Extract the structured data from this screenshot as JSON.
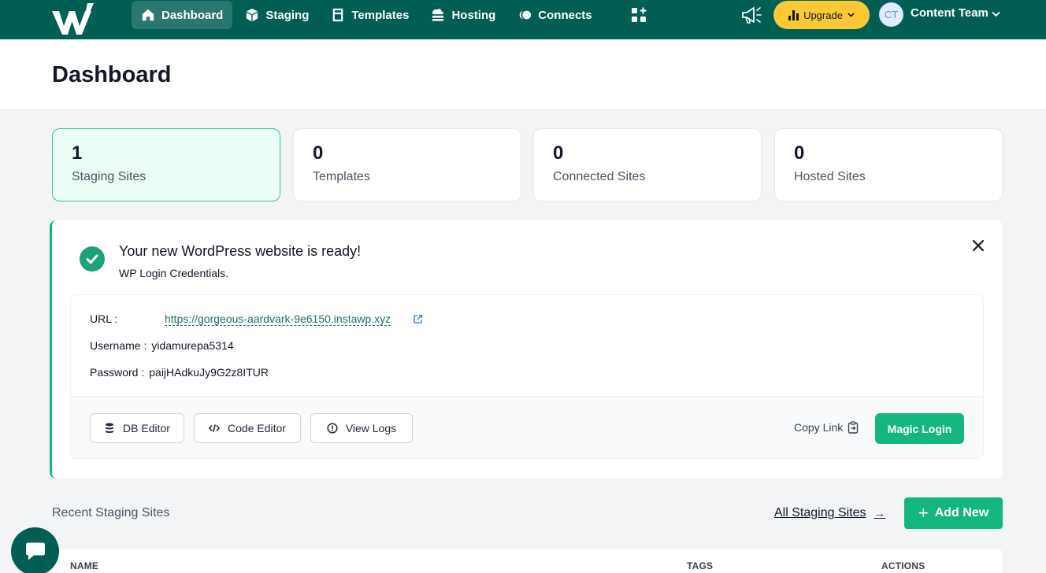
{
  "nav": {
    "items": [
      {
        "label": "Dashboard",
        "icon": "home-icon",
        "active": true
      },
      {
        "label": "Staging",
        "icon": "cube-icon",
        "active": false
      },
      {
        "label": "Templates",
        "icon": "templates-icon",
        "active": false
      },
      {
        "label": "Hosting",
        "icon": "cloud-server-icon",
        "active": false
      },
      {
        "label": "Connects",
        "icon": "connects-icon",
        "active": false
      }
    ],
    "upgrade_label": "Upgrade",
    "avatar_initials": "CT",
    "team_name": "Content Team",
    "colors": {
      "bar": "#005e54",
      "upgrade": "#fcc934"
    }
  },
  "header": {
    "title": "Dashboard"
  },
  "stats": [
    {
      "value": "1",
      "label": "Staging Sites",
      "active": true
    },
    {
      "value": "0",
      "label": "Templates",
      "active": false
    },
    {
      "value": "0",
      "label": "Connected Sites",
      "active": false
    },
    {
      "value": "0",
      "label": "Hosted Sites",
      "active": false
    }
  ],
  "notice": {
    "title": "Your new WordPress website is ready!",
    "subtitle": "WP Login Credentials.",
    "url_label": "URL :",
    "url_value": "https://gorgeous-aardvark-9e6150.instawp.xyz",
    "username_label": "Username :",
    "username_value": "yidamurepa5314",
    "password_label": "Password :",
    "password_value": "paijHAdkuJy9G2z8ITUR",
    "buttons": {
      "db_editor": "DB Editor",
      "code_editor": "Code Editor",
      "view_logs": "View Logs",
      "copy_link": "Copy Link",
      "magic_login": "Magic Login"
    },
    "accent": "#17b783"
  },
  "recent": {
    "title": "Recent Staging Sites",
    "all_link": "All Staging Sites",
    "arrow": "→",
    "add_new": "Add New",
    "add_plus": "+",
    "columns": {
      "name": "NAME",
      "tags": "TAGS",
      "actions": "ACTIONS"
    }
  }
}
